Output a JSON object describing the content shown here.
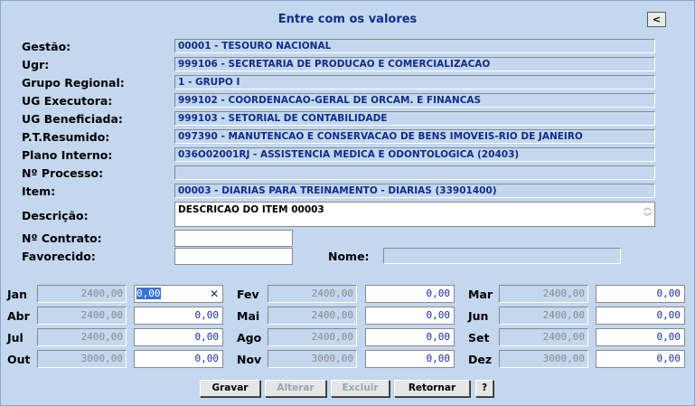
{
  "title": "Entre com os valores",
  "back_label": "<",
  "fields": [
    {
      "label": "Gestão:",
      "value": "00001 - TESOURO NACIONAL"
    },
    {
      "label": "Ugr:",
      "value": "999106 - SECRETARIA DE PRODUCAO E COMERCIALIZACAO"
    },
    {
      "label": "Grupo Regional:",
      "value": "1 - GRUPO I"
    },
    {
      "label": "UG Executora:",
      "value": "999102 - COORDENACAO-GERAL DE ORCAM. E FINANCAS"
    },
    {
      "label": "UG Beneficiada:",
      "value": "999103 - SETORIAL DE CONTABILIDADE"
    },
    {
      "label": "P.T.Resumido:",
      "value": "097390 - MANUTENCAO E CONSERVACAO DE BENS IMOVEIS-RIO DE JANEIRO"
    },
    {
      "label": "Plano Interno:",
      "value": "036O02001RJ - ASSISTENCIA MEDICA E ODONTOLOGICA (20403)"
    },
    {
      "label": "Nº Processo:",
      "value": ""
    },
    {
      "label": "Item:",
      "value": "00003 - DIARIAS PARA TREINAMENTO - DIARIAS (33901400)"
    }
  ],
  "descricao": {
    "label": "Descrição:",
    "value": "DESCRICAO DO ITEM 00003"
  },
  "contrato": {
    "label": "Nº Contrato:",
    "value": ""
  },
  "favorecido": {
    "label": "Favorecido:",
    "value": ""
  },
  "nome": {
    "label": "Nome:",
    "value": ""
  },
  "months": [
    {
      "name": "Jan",
      "prev": "2400,00",
      "value": "0,00"
    },
    {
      "name": "Fev",
      "prev": "2400,00",
      "value": "0,00"
    },
    {
      "name": "Mar",
      "prev": "2400,00",
      "value": "0,00"
    },
    {
      "name": "Abr",
      "prev": "2400,00",
      "value": "0,00"
    },
    {
      "name": "Mai",
      "prev": "2400,00",
      "value": "0,00"
    },
    {
      "name": "Jun",
      "prev": "2400,00",
      "value": "0,00"
    },
    {
      "name": "Jul",
      "prev": "2400,00",
      "value": "0,00"
    },
    {
      "name": "Ago",
      "prev": "2400,00",
      "value": "0,00"
    },
    {
      "name": "Set",
      "prev": "2400,00",
      "value": "0,00"
    },
    {
      "name": "Out",
      "prev": "3000,00",
      "value": "0,00"
    },
    {
      "name": "Nov",
      "prev": "3000,00",
      "value": "0,00"
    },
    {
      "name": "Dez",
      "prev": "3000,00",
      "value": "0,00"
    }
  ],
  "clear_glyph": "✕",
  "buttons": {
    "gravar": "Gravar",
    "alterar": "Alterar",
    "excluir": "Excluir",
    "retornar": "Retornar",
    "help": "?"
  },
  "colors": {
    "background": "#c3d7ef",
    "title": "#0f2f8a",
    "value_text": "#102c8c"
  }
}
